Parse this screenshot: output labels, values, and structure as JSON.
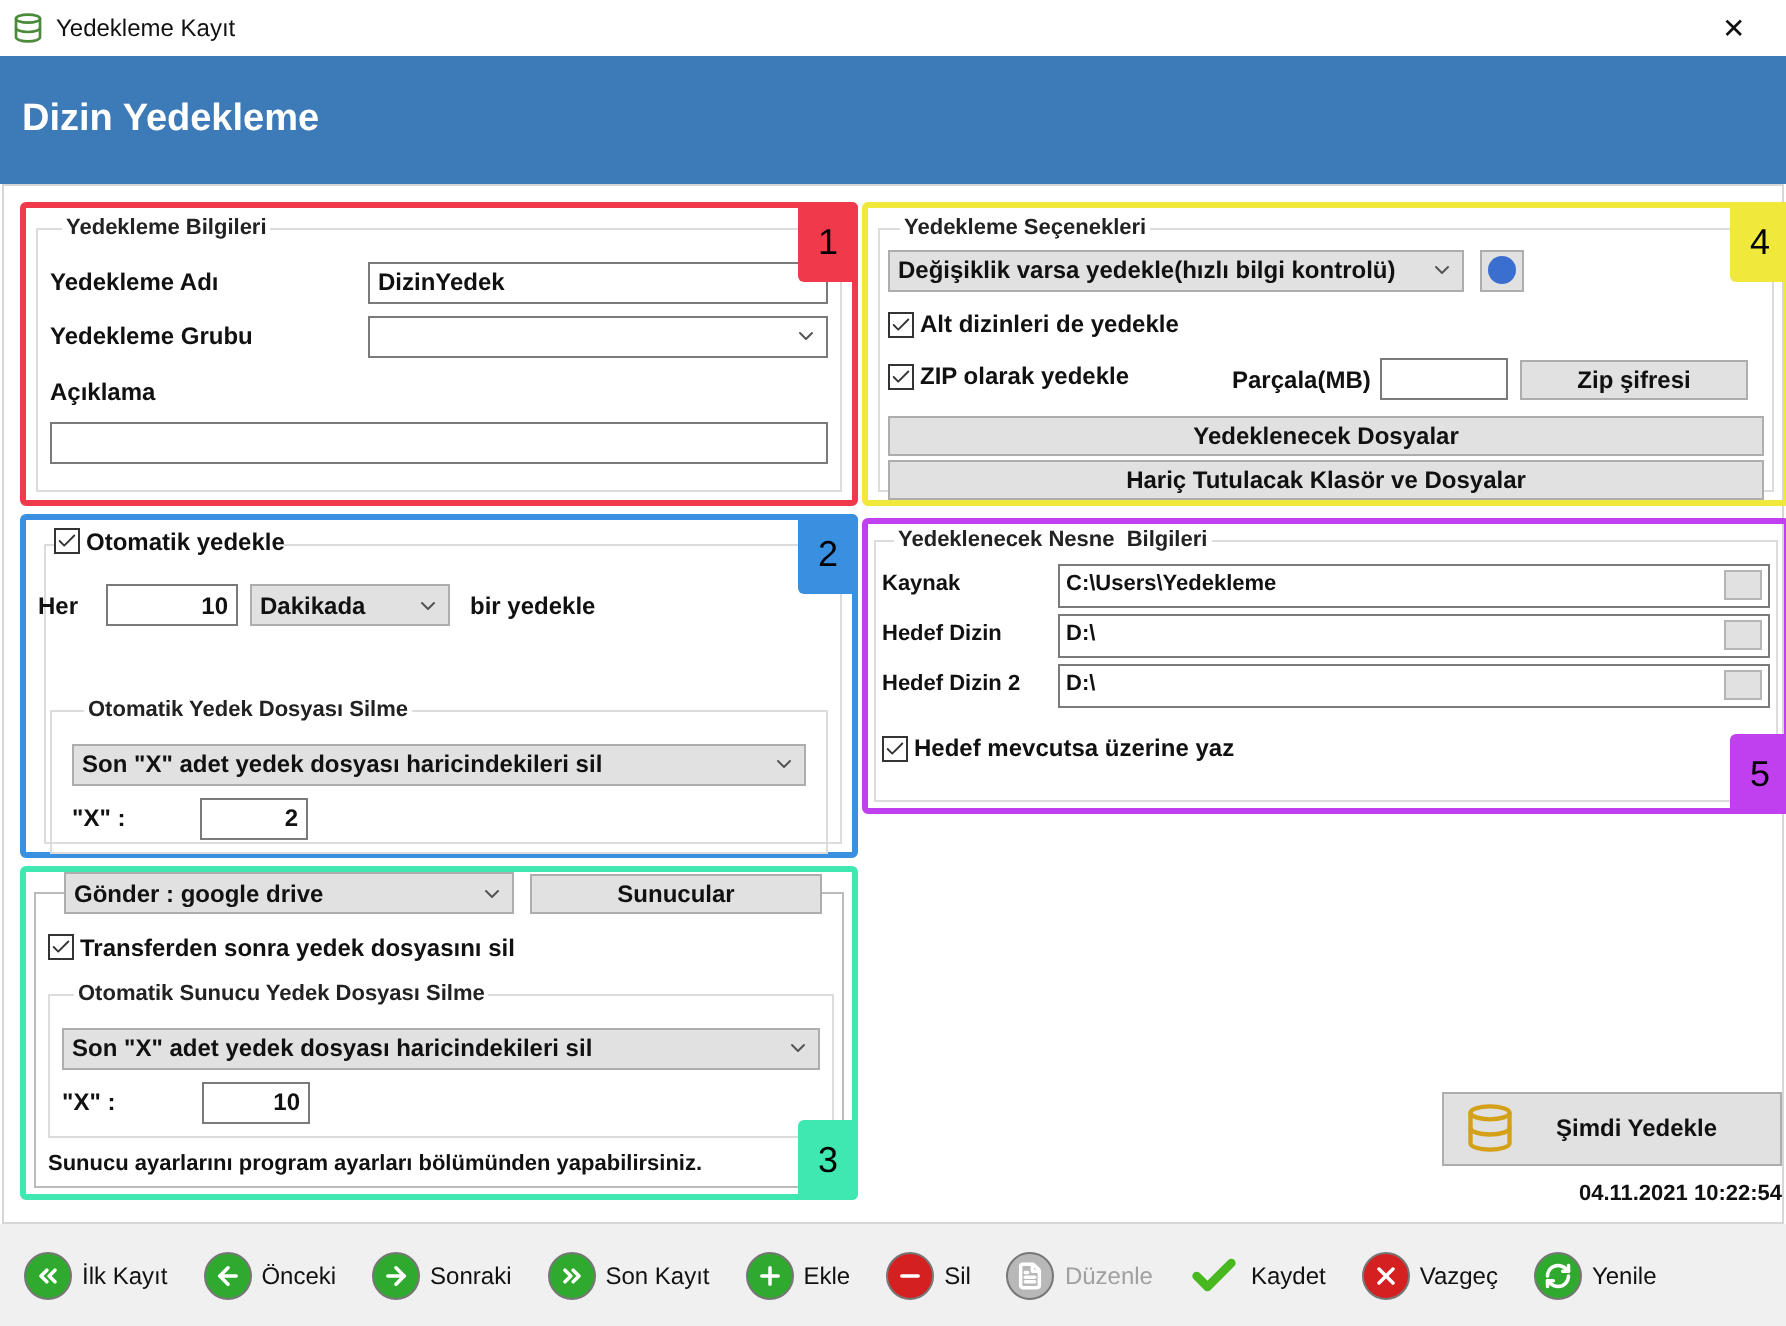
{
  "window": {
    "title": "Yedekleme Kayıt",
    "close": "✕"
  },
  "header": {
    "title": "Dizin Yedekleme"
  },
  "info": {
    "badge": "1",
    "legend": "Yedekleme Bilgileri",
    "name_label": "Yedekleme Adı",
    "name_value": "DizinYedek",
    "group_label": "Yedekleme Grubu",
    "description_label": "Açıklama"
  },
  "auto": {
    "badge": "2",
    "checkbox": {
      "label": "Otomatik yedekle",
      "checked": true
    },
    "every_label": "Her",
    "every_value": "10",
    "unit": "Dakikada",
    "suffix": "bir yedekle",
    "delete_legend": "Otomatik Yedek Dosyası Silme",
    "delete_rule": "Son \"X\" adet yedek dosyası haricindekileri sil",
    "x_label": "\"X\" :",
    "x_value": "2"
  },
  "send": {
    "badge": "3",
    "target": "Gönder : google drive",
    "servers_button": "Sunucular",
    "checkbox": {
      "label": "Transferden sonra yedek dosyasını sil",
      "checked": true
    },
    "delete_legend": "Otomatik Sunucu Yedek Dosyası Silme",
    "delete_rule": "Son \"X\" adet yedek dosyası haricindekileri sil",
    "x_label": "\"X\" :",
    "x_value": "10",
    "note": "Sunucu ayarlarını program ayarları bölümünden yapabilirsiniz."
  },
  "options": {
    "badge": "4",
    "legend": "Yedekleme Seçenekleri",
    "mode": "Değişiklik varsa yedekle(hızlı bilgi kontrolü)",
    "checkboxes": [
      {
        "label": "Alt dizinleri de yedekle",
        "checked": true
      },
      {
        "label": "ZIP olarak yedekle",
        "checked": true
      }
    ],
    "split_label": "Parçala(MB)",
    "zip_password_button": "Zip şifresi",
    "buttons": [
      "Yedeklenecek Dosyalar",
      "Hariç Tutulacak Klasör ve Dosyalar"
    ]
  },
  "object": {
    "badge": "5",
    "legend": "Yedeklenecek Nesne  Bilgileri",
    "paths": [
      {
        "label": "Kaynak",
        "value": "C:\\Users\\Yedekleme"
      },
      {
        "label": "Hedef Dizin",
        "value": "D:\\"
      },
      {
        "label": "Hedef Dizin 2",
        "value": "D:\\"
      }
    ],
    "checkbox": {
      "label": "Hedef mevcutsa üzerine yaz",
      "checked": true
    }
  },
  "backup_now": {
    "label": "Şimdi Yedekle",
    "timestamp": "04.11.2021 10:22:54"
  },
  "toolbar": [
    {
      "kind": "first",
      "label": "İlk Kayıt",
      "disabled": false
    },
    {
      "kind": "prev",
      "label": "Önceki",
      "disabled": false
    },
    {
      "kind": "next",
      "label": "Sonraki",
      "disabled": false
    },
    {
      "kind": "last",
      "label": "Son Kayıt",
      "disabled": false
    },
    {
      "kind": "add",
      "label": "Ekle",
      "disabled": false
    },
    {
      "kind": "delete",
      "label": "Sil",
      "disabled": false
    },
    {
      "kind": "edit",
      "label": "Düzenle",
      "disabled": true
    },
    {
      "kind": "save",
      "label": "Kaydet",
      "disabled": false
    },
    {
      "kind": "cancel",
      "label": "Vazgeç",
      "disabled": false
    },
    {
      "kind": "refresh",
      "label": "Yenile",
      "disabled": false
    }
  ]
}
